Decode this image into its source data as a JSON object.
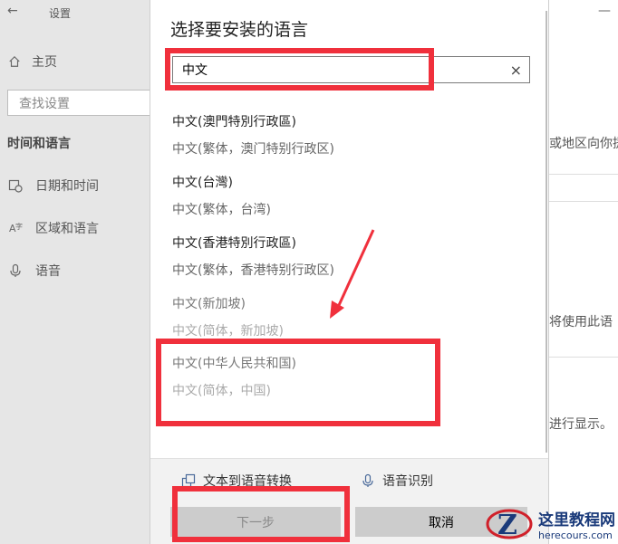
{
  "settings": {
    "back_icon": "arrow-left-icon",
    "title": "设置",
    "home_label": "主页",
    "search_placeholder": "查找设置",
    "section_title": "时间和语言",
    "items": [
      {
        "label": "日期和时间",
        "icon": "calendar-clock-icon"
      },
      {
        "label": "区域和语言",
        "icon": "language-icon"
      },
      {
        "label": "语音",
        "icon": "microphone-icon"
      }
    ]
  },
  "background": {
    "minimize": "—",
    "text1": "或地区向你提",
    "text2": "将使用此语",
    "text3": "进行显示。"
  },
  "dialog": {
    "title": "选择要安装的语言",
    "search_value": "中文",
    "clear_icon": "×",
    "languages": [
      {
        "name": "中文(澳門特別行政區)",
        "sub": "中文(繁体，澳门特别行政区)",
        "enabled": true
      },
      {
        "name": "中文(台灣)",
        "sub": "中文(繁体，台湾)",
        "enabled": true
      },
      {
        "name": "中文(香港特別行政區)",
        "sub": "中文(繁体，香港特别行政区)",
        "enabled": true
      },
      {
        "name": "中文(新加坡)",
        "sub": "中文(简体，新加坡)",
        "enabled": false
      },
      {
        "name": "中文(中华人民共和国)",
        "sub": "中文(简体，中国)",
        "enabled": false
      }
    ],
    "features": [
      {
        "label": "文本到语音转换",
        "icon": "text-to-speech-icon"
      },
      {
        "label": "语音识别",
        "icon": "microphone-icon"
      }
    ],
    "next_label": "下一步",
    "cancel_label": "取消"
  },
  "watermark": {
    "title": "这里教程网",
    "url": "herecours.com"
  },
  "colors": {
    "annotation_red": "#f0303c",
    "sidebar_bg": "#e6e6e6",
    "button_bg": "#cccccc"
  }
}
